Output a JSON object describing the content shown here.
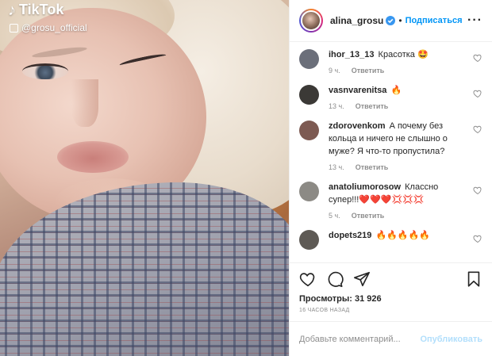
{
  "media": {
    "watermark_brand": "TikTok",
    "watermark_handle": "@grosu_official"
  },
  "header": {
    "username": "alina_grosu",
    "separator": "•",
    "follow_label": "Подписаться",
    "more_label": "···"
  },
  "comments": [
    {
      "user": "ihor_13_13",
      "text": "Красотка 🤩",
      "time": "9 ч.",
      "reply": "Ответить",
      "avatar_color": "#6b6f7a"
    },
    {
      "user": "vasnvarenitsa",
      "text": "🔥",
      "time": "13 ч.",
      "reply": "Ответить",
      "avatar_color": "#3b3936"
    },
    {
      "user": "zdorovenkom",
      "text": "А почему без кольца и ничего не слышно о муже? Я что-то пропустила?",
      "time": "13 ч.",
      "reply": "Ответить",
      "avatar_color": "#7d5a52"
    },
    {
      "user": "anatoliumorosow",
      "text": "Классно супер!!!❤️❤️❤️💢💢💢",
      "time": "5 ч.",
      "reply": "Ответить",
      "avatar_color": "#8c8a85"
    },
    {
      "user": "dopets219",
      "text": "🔥🔥🔥🔥🔥",
      "time": "",
      "reply": "",
      "avatar_color": "#5e5a55"
    }
  ],
  "stats": {
    "views_label": "Просмотры: 31 926",
    "timestamp": "16 ЧАСОВ НАЗАД"
  },
  "compose": {
    "placeholder": "Добавьте комментарий...",
    "publish_label": "Опубликовать"
  },
  "colors": {
    "accent": "#0095f6",
    "publish_disabled": "#b2dffc",
    "muted": "#8e8e8e"
  }
}
